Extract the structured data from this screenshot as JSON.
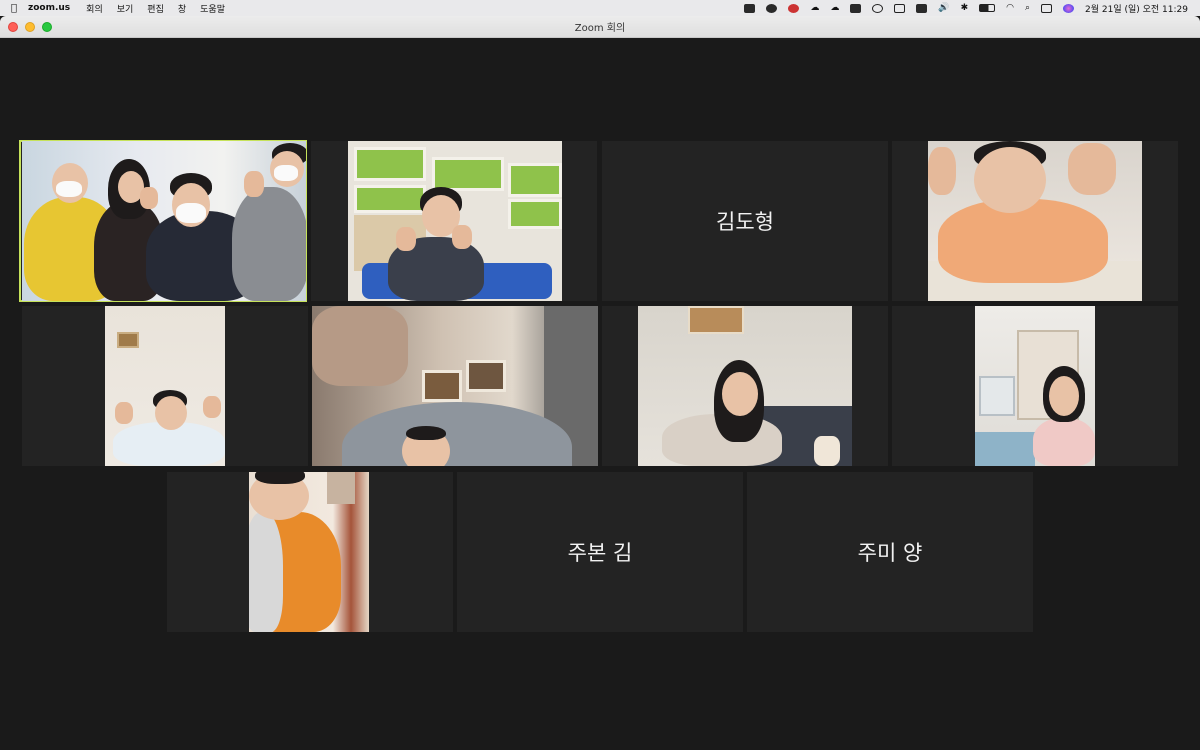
{
  "menubar": {
    "app_name": "zoom.us",
    "menus": [
      "회의",
      "보기",
      "편집",
      "창",
      "도움말"
    ],
    "clock": "2월 21일 (일) 오전 11:29"
  },
  "window": {
    "title": "Zoom 회의"
  },
  "participants": [
    {
      "name": "김도형",
      "video": false
    },
    {
      "name": "주본 김",
      "video": false
    },
    {
      "name": "주미 양",
      "video": false
    }
  ],
  "colors": {
    "active_speaker_border": "#c6e25a",
    "tile_bg": "#232323",
    "stage_bg": "#1a1a1a"
  }
}
